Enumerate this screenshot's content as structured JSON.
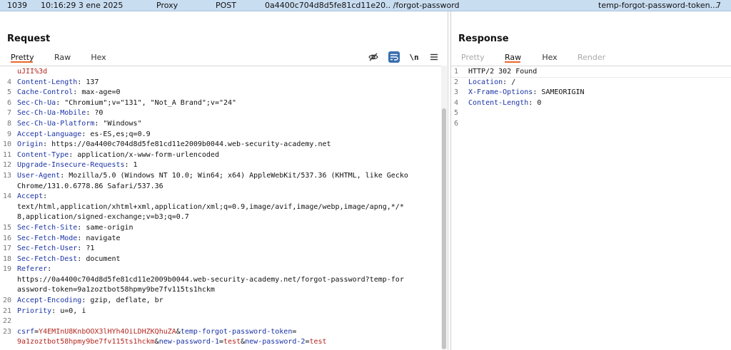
{
  "history_row": {
    "id": "1039",
    "time": "10:16:29 3 ene 2025",
    "tool": "Proxy",
    "method": "POST",
    "url": "0a4400c704d8d5fe81cd11e20.. /forgot-password",
    "params": "temp-forgot-password-token...",
    "count": "7"
  },
  "request": {
    "title": "Request",
    "tabs": [
      "Pretty",
      "Raw",
      "Hex"
    ],
    "active_tab": "Pretty",
    "toolbar": {
      "newline_label": "\\n"
    },
    "lines": [
      {
        "n": "",
        "parts": [
          {
            "t": "uJII%3d",
            "c": "red"
          }
        ]
      },
      {
        "n": "4",
        "parts": [
          {
            "t": "Content-Length",
            "c": "hname"
          },
          {
            "t": ": 137",
            "c": "hval"
          }
        ]
      },
      {
        "n": "5",
        "parts": [
          {
            "t": "Cache-Control",
            "c": "hname"
          },
          {
            "t": ": max-age=0",
            "c": "hval"
          }
        ]
      },
      {
        "n": "6",
        "parts": [
          {
            "t": "Sec-Ch-Ua",
            "c": "hname"
          },
          {
            "t": ": \"Chromium\";v=\"131\", \"Not_A Brand\";v=\"24\"",
            "c": "hval"
          }
        ]
      },
      {
        "n": "7",
        "parts": [
          {
            "t": "Sec-Ch-Ua-Mobile",
            "c": "hname"
          },
          {
            "t": ": ?0",
            "c": "hval"
          }
        ]
      },
      {
        "n": "8",
        "parts": [
          {
            "t": "Sec-Ch-Ua-Platform",
            "c": "hname"
          },
          {
            "t": ": \"Windows\"",
            "c": "hval"
          }
        ]
      },
      {
        "n": "9",
        "parts": [
          {
            "t": "Accept-Language",
            "c": "hname"
          },
          {
            "t": ": es-ES,es;q=0.9",
            "c": "hval"
          }
        ]
      },
      {
        "n": "10",
        "parts": [
          {
            "t": "Origin",
            "c": "hname"
          },
          {
            "t": ": https://0a4400c704d8d5fe81cd11e2009b0044.web-security-academy.net",
            "c": "hval"
          }
        ]
      },
      {
        "n": "11",
        "parts": [
          {
            "t": "Content-Type",
            "c": "hname"
          },
          {
            "t": ": application/x-www-form-urlencoded",
            "c": "hval"
          }
        ]
      },
      {
        "n": "12",
        "parts": [
          {
            "t": "Upgrade-Insecure-Requests",
            "c": "hname"
          },
          {
            "t": ": 1",
            "c": "hval"
          }
        ]
      },
      {
        "n": "13",
        "parts": [
          {
            "t": "User-Agent",
            "c": "hname"
          },
          {
            "t": ": Mozilla/5.0 (Windows NT 10.0; Win64; x64) AppleWebKit/537.36 (KHTML, like Gecko",
            "c": "hval"
          }
        ]
      },
      {
        "n": "",
        "parts": [
          {
            "t": "Chrome/131.0.6778.86 Safari/537.36",
            "c": "hval"
          }
        ]
      },
      {
        "n": "14",
        "parts": [
          {
            "t": "Accept",
            "c": "hname"
          },
          {
            "t": ":",
            "c": "hval"
          }
        ]
      },
      {
        "n": "",
        "parts": [
          {
            "t": "text/html,application/xhtml+xml,application/xml;q=0.9,image/avif,image/webp,image/apng,*/*",
            "c": "hval"
          }
        ]
      },
      {
        "n": "",
        "parts": [
          {
            "t": "8,application/signed-exchange;v=b3;q=0.7",
            "c": "hval"
          }
        ]
      },
      {
        "n": "15",
        "parts": [
          {
            "t": "Sec-Fetch-Site",
            "c": "hname"
          },
          {
            "t": ": same-origin",
            "c": "hval"
          }
        ]
      },
      {
        "n": "16",
        "parts": [
          {
            "t": "Sec-Fetch-Mode",
            "c": "hname"
          },
          {
            "t": ": navigate",
            "c": "hval"
          }
        ]
      },
      {
        "n": "17",
        "parts": [
          {
            "t": "Sec-Fetch-User",
            "c": "hname"
          },
          {
            "t": ": ?1",
            "c": "hval"
          }
        ]
      },
      {
        "n": "18",
        "parts": [
          {
            "t": "Sec-Fetch-Dest",
            "c": "hname"
          },
          {
            "t": ": document",
            "c": "hval"
          }
        ]
      },
      {
        "n": "19",
        "parts": [
          {
            "t": "Referer",
            "c": "hname"
          },
          {
            "t": ":",
            "c": "hval"
          }
        ]
      },
      {
        "n": "",
        "parts": [
          {
            "t": "https://0a4400c704d8d5fe81cd11e2009b0044.web-security-academy.net/forgot-password?temp-for",
            "c": "hval"
          }
        ]
      },
      {
        "n": "",
        "parts": [
          {
            "t": "assword-token=9a1zoztbot58hpmy9be7fv115ts1hckm",
            "c": "hval"
          }
        ]
      },
      {
        "n": "20",
        "parts": [
          {
            "t": "Accept-Encoding",
            "c": "hname"
          },
          {
            "t": ": gzip, deflate, br",
            "c": "hval"
          }
        ]
      },
      {
        "n": "21",
        "parts": [
          {
            "t": "Priority",
            "c": "hname"
          },
          {
            "t": ": u=0, i",
            "c": "hval"
          }
        ]
      },
      {
        "n": "22",
        "parts": []
      },
      {
        "n": "23",
        "parts": [
          {
            "t": "csrf",
            "c": "blue"
          },
          {
            "t": "=",
            "c": "hval"
          },
          {
            "t": "Y4EMInU8KnbOOX3lHYh4OiLDHZKQhuZA",
            "c": "red"
          },
          {
            "t": "&",
            "c": "hval"
          },
          {
            "t": "temp-forgot-password-token",
            "c": "blue"
          },
          {
            "t": "=",
            "c": "hval"
          }
        ]
      },
      {
        "n": "",
        "parts": [
          {
            "t": "9a1zoztbot58hpmy9be7fv115ts1hckm",
            "c": "red"
          },
          {
            "t": "&",
            "c": "hval"
          },
          {
            "t": "new-password-1",
            "c": "blue"
          },
          {
            "t": "=",
            "c": "hval"
          },
          {
            "t": "test",
            "c": "red"
          },
          {
            "t": "&",
            "c": "hval"
          },
          {
            "t": "new-password-2",
            "c": "blue"
          },
          {
            "t": "=",
            "c": "hval"
          },
          {
            "t": "test",
            "c": "red"
          }
        ]
      }
    ]
  },
  "response": {
    "title": "Response",
    "tabs": [
      "Pretty",
      "Raw",
      "Hex",
      "Render"
    ],
    "active_tab": "Raw",
    "lines": [
      {
        "n": "1",
        "parts": [
          {
            "t": "HTTP/2 302 Found",
            "c": "hval"
          }
        ]
      },
      {
        "n": "2",
        "parts": [
          {
            "t": "Location",
            "c": "hname"
          },
          {
            "t": ": /",
            "c": "hval"
          }
        ]
      },
      {
        "n": "3",
        "parts": [
          {
            "t": "X-Frame-Options",
            "c": "hname"
          },
          {
            "t": ": SAMEORIGIN",
            "c": "hval"
          }
        ]
      },
      {
        "n": "4",
        "parts": [
          {
            "t": "Content-Length",
            "c": "hname"
          },
          {
            "t": ": 0",
            "c": "hval"
          }
        ]
      },
      {
        "n": "5",
        "parts": []
      },
      {
        "n": "6",
        "parts": []
      }
    ]
  }
}
